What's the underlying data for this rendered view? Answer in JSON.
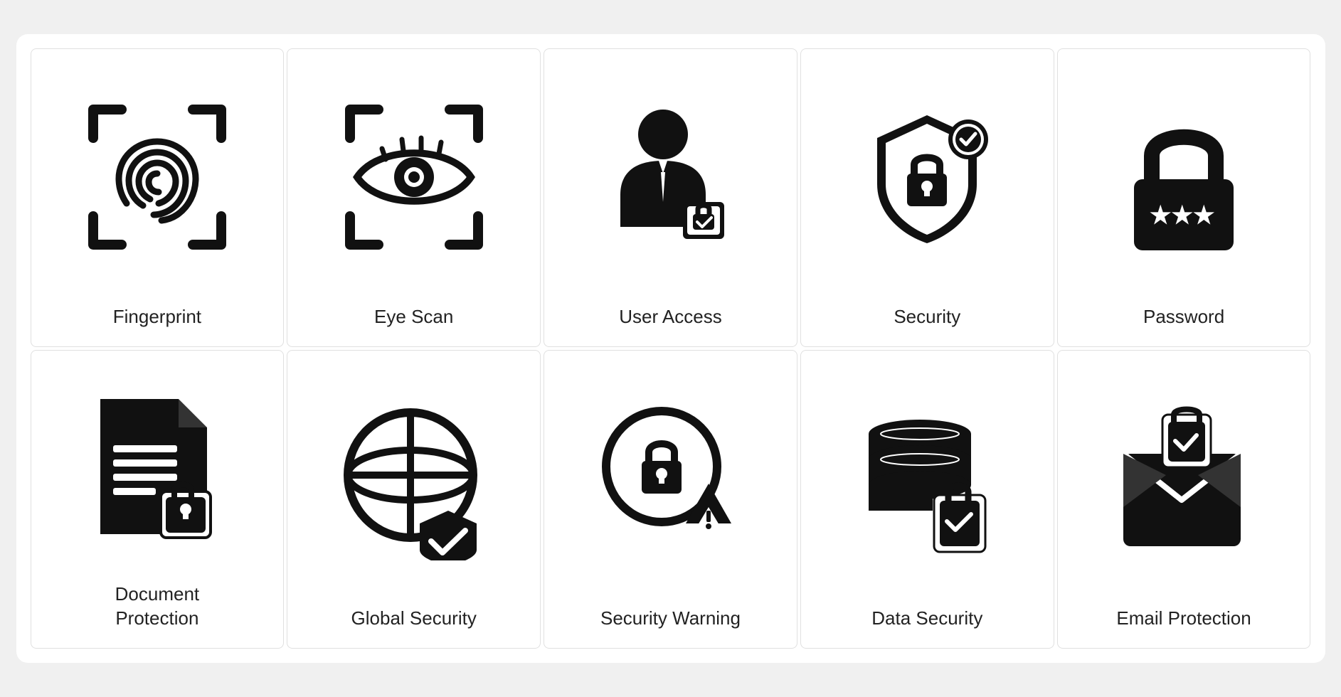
{
  "items": [
    {
      "id": "fingerprint",
      "label": "Fingerprint"
    },
    {
      "id": "eye-scan",
      "label": "Eye Scan"
    },
    {
      "id": "user-access",
      "label": "User Access"
    },
    {
      "id": "security",
      "label": "Security"
    },
    {
      "id": "password",
      "label": "Password"
    },
    {
      "id": "document-protection",
      "label": "Document\nProtection"
    },
    {
      "id": "global-security",
      "label": "Global Security"
    },
    {
      "id": "security-warning",
      "label": "Security Warning"
    },
    {
      "id": "data-security",
      "label": "Data Security"
    },
    {
      "id": "email-protection",
      "label": "Email Protection"
    }
  ]
}
